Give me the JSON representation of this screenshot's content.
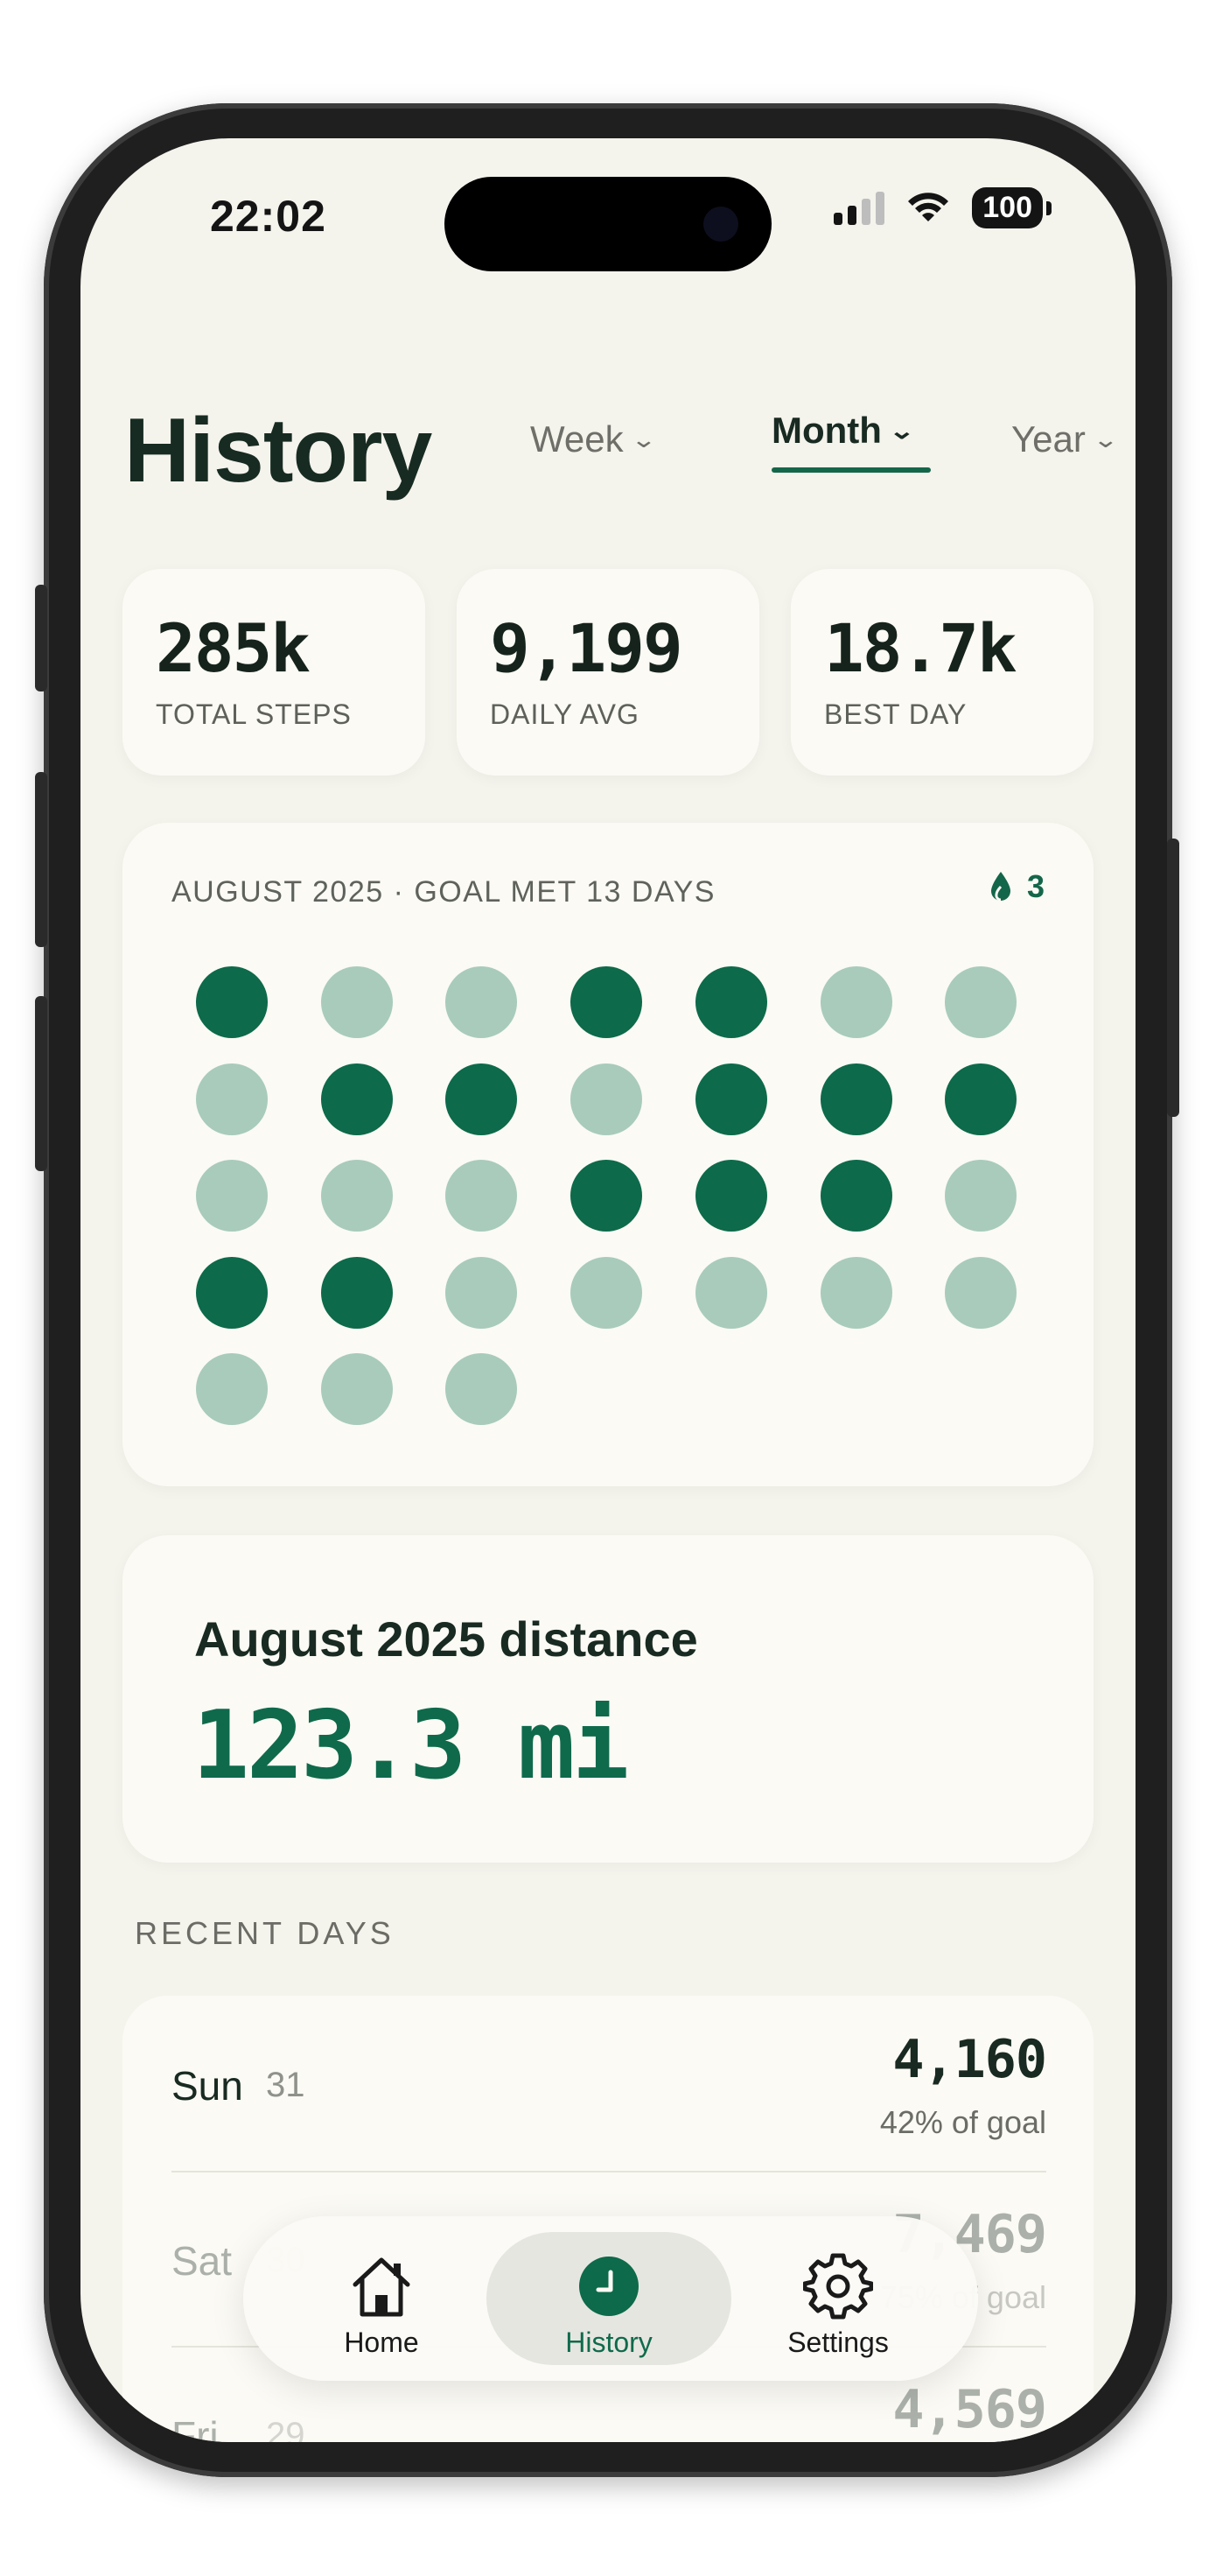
{
  "status_bar": {
    "time": "22:02",
    "battery": "100"
  },
  "header": {
    "title": "History",
    "ranges": [
      {
        "label": "Week",
        "active": false
      },
      {
        "label": "Month",
        "active": true
      },
      {
        "label": "Year",
        "active": false
      }
    ]
  },
  "stats": [
    {
      "value": "285k",
      "label": "TOTAL STEPS"
    },
    {
      "value": "9,199",
      "label": "DAILY AVG"
    },
    {
      "value": "18.7k",
      "label": "BEST DAY"
    }
  ],
  "calendar": {
    "heading": "AUGUST 2025 · GOAL MET 13 DAYS",
    "streak": "3",
    "days_goal_met": [
      true,
      false,
      false,
      true,
      true,
      false,
      false,
      false,
      true,
      true,
      false,
      true,
      true,
      true,
      false,
      false,
      false,
      true,
      true,
      true,
      false,
      true,
      true,
      false,
      false,
      false,
      false,
      false,
      false,
      false,
      false
    ]
  },
  "distance": {
    "label": "August 2025 distance",
    "value": "123.3 mi"
  },
  "recent": {
    "heading": "RECENT DAYS",
    "days": [
      {
        "name": "Sun",
        "num": "31",
        "steps": "4,160",
        "pct": "42% of goal"
      },
      {
        "name": "Sat",
        "num": "30",
        "steps": "7,469",
        "pct": "75% of goal"
      },
      {
        "name": "Fri",
        "num": "29",
        "steps": "4,569",
        "pct": ""
      }
    ]
  },
  "tabbar": {
    "items": [
      {
        "label": "Home",
        "icon": "home-icon"
      },
      {
        "label": "History",
        "icon": "clock-icon",
        "active": true
      },
      {
        "label": "Settings",
        "icon": "gear-icon"
      }
    ]
  },
  "colors": {
    "accent": "#0d6a4b",
    "accent_light": "#a8cbbc",
    "background": "#f4f3ec",
    "card": "#fbfaf4"
  }
}
